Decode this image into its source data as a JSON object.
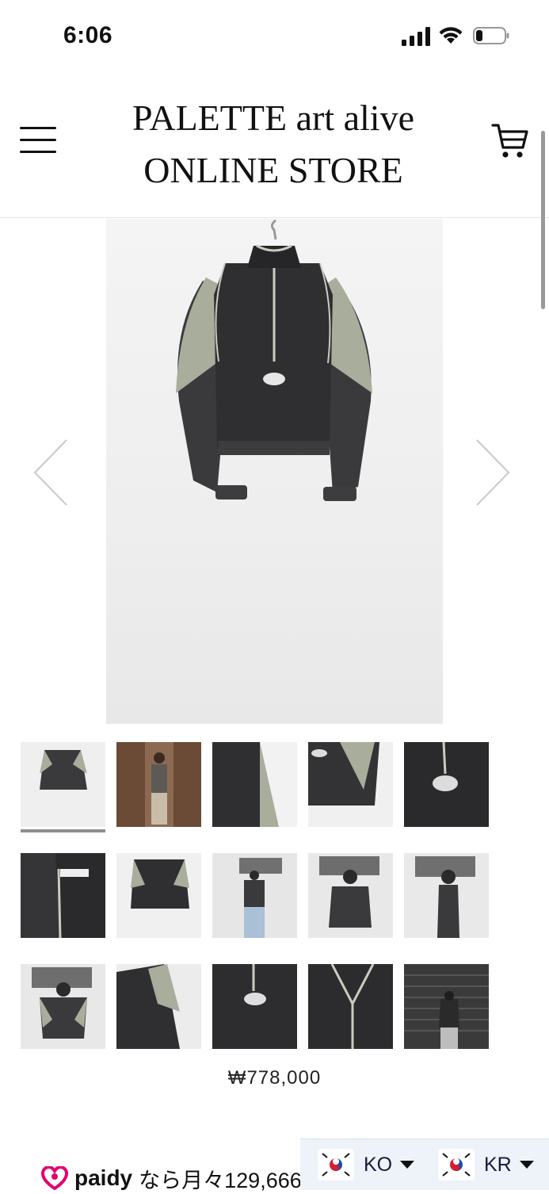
{
  "status_bar": {
    "time": "6:06"
  },
  "header": {
    "brand_line1": "PALETTE art alive",
    "brand_line2": "ONLINE STORE"
  },
  "gallery": {
    "thumbnail_count": 15,
    "active_index": 0
  },
  "product": {
    "price": "₩778,000"
  },
  "paidy": {
    "logo": "paidy",
    "text": "なら月々129,666"
  },
  "locale": {
    "language": "KO",
    "country": "KR"
  },
  "icons": {
    "menu": "hamburger-icon",
    "cart": "cart-icon",
    "prev": "chevron-left-icon",
    "next": "chevron-right-icon",
    "flag": "south-korea-flag-icon"
  },
  "colors": {
    "accent_paidy": "#e5006e",
    "lang_bar_bg": "#eef2f9"
  }
}
